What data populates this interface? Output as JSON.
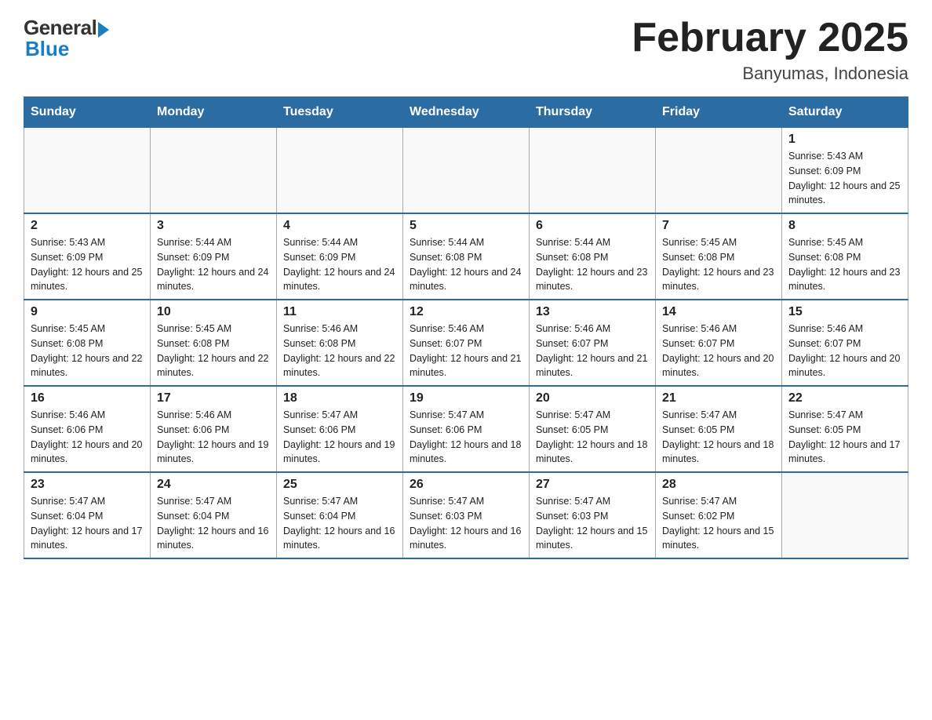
{
  "header": {
    "logo_general": "General",
    "logo_blue": "Blue",
    "month_title": "February 2025",
    "location": "Banyumas, Indonesia"
  },
  "weekdays": [
    "Sunday",
    "Monday",
    "Tuesday",
    "Wednesday",
    "Thursday",
    "Friday",
    "Saturday"
  ],
  "weeks": [
    [
      {
        "day": "",
        "info": ""
      },
      {
        "day": "",
        "info": ""
      },
      {
        "day": "",
        "info": ""
      },
      {
        "day": "",
        "info": ""
      },
      {
        "day": "",
        "info": ""
      },
      {
        "day": "",
        "info": ""
      },
      {
        "day": "1",
        "info": "Sunrise: 5:43 AM\nSunset: 6:09 PM\nDaylight: 12 hours and 25 minutes."
      }
    ],
    [
      {
        "day": "2",
        "info": "Sunrise: 5:43 AM\nSunset: 6:09 PM\nDaylight: 12 hours and 25 minutes."
      },
      {
        "day": "3",
        "info": "Sunrise: 5:44 AM\nSunset: 6:09 PM\nDaylight: 12 hours and 24 minutes."
      },
      {
        "day": "4",
        "info": "Sunrise: 5:44 AM\nSunset: 6:09 PM\nDaylight: 12 hours and 24 minutes."
      },
      {
        "day": "5",
        "info": "Sunrise: 5:44 AM\nSunset: 6:08 PM\nDaylight: 12 hours and 24 minutes."
      },
      {
        "day": "6",
        "info": "Sunrise: 5:44 AM\nSunset: 6:08 PM\nDaylight: 12 hours and 23 minutes."
      },
      {
        "day": "7",
        "info": "Sunrise: 5:45 AM\nSunset: 6:08 PM\nDaylight: 12 hours and 23 minutes."
      },
      {
        "day": "8",
        "info": "Sunrise: 5:45 AM\nSunset: 6:08 PM\nDaylight: 12 hours and 23 minutes."
      }
    ],
    [
      {
        "day": "9",
        "info": "Sunrise: 5:45 AM\nSunset: 6:08 PM\nDaylight: 12 hours and 22 minutes."
      },
      {
        "day": "10",
        "info": "Sunrise: 5:45 AM\nSunset: 6:08 PM\nDaylight: 12 hours and 22 minutes."
      },
      {
        "day": "11",
        "info": "Sunrise: 5:46 AM\nSunset: 6:08 PM\nDaylight: 12 hours and 22 minutes."
      },
      {
        "day": "12",
        "info": "Sunrise: 5:46 AM\nSunset: 6:07 PM\nDaylight: 12 hours and 21 minutes."
      },
      {
        "day": "13",
        "info": "Sunrise: 5:46 AM\nSunset: 6:07 PM\nDaylight: 12 hours and 21 minutes."
      },
      {
        "day": "14",
        "info": "Sunrise: 5:46 AM\nSunset: 6:07 PM\nDaylight: 12 hours and 20 minutes."
      },
      {
        "day": "15",
        "info": "Sunrise: 5:46 AM\nSunset: 6:07 PM\nDaylight: 12 hours and 20 minutes."
      }
    ],
    [
      {
        "day": "16",
        "info": "Sunrise: 5:46 AM\nSunset: 6:06 PM\nDaylight: 12 hours and 20 minutes."
      },
      {
        "day": "17",
        "info": "Sunrise: 5:46 AM\nSunset: 6:06 PM\nDaylight: 12 hours and 19 minutes."
      },
      {
        "day": "18",
        "info": "Sunrise: 5:47 AM\nSunset: 6:06 PM\nDaylight: 12 hours and 19 minutes."
      },
      {
        "day": "19",
        "info": "Sunrise: 5:47 AM\nSunset: 6:06 PM\nDaylight: 12 hours and 18 minutes."
      },
      {
        "day": "20",
        "info": "Sunrise: 5:47 AM\nSunset: 6:05 PM\nDaylight: 12 hours and 18 minutes."
      },
      {
        "day": "21",
        "info": "Sunrise: 5:47 AM\nSunset: 6:05 PM\nDaylight: 12 hours and 18 minutes."
      },
      {
        "day": "22",
        "info": "Sunrise: 5:47 AM\nSunset: 6:05 PM\nDaylight: 12 hours and 17 minutes."
      }
    ],
    [
      {
        "day": "23",
        "info": "Sunrise: 5:47 AM\nSunset: 6:04 PM\nDaylight: 12 hours and 17 minutes."
      },
      {
        "day": "24",
        "info": "Sunrise: 5:47 AM\nSunset: 6:04 PM\nDaylight: 12 hours and 16 minutes."
      },
      {
        "day": "25",
        "info": "Sunrise: 5:47 AM\nSunset: 6:04 PM\nDaylight: 12 hours and 16 minutes."
      },
      {
        "day": "26",
        "info": "Sunrise: 5:47 AM\nSunset: 6:03 PM\nDaylight: 12 hours and 16 minutes."
      },
      {
        "day": "27",
        "info": "Sunrise: 5:47 AM\nSunset: 6:03 PM\nDaylight: 12 hours and 15 minutes."
      },
      {
        "day": "28",
        "info": "Sunrise: 5:47 AM\nSunset: 6:02 PM\nDaylight: 12 hours and 15 minutes."
      },
      {
        "day": "",
        "info": ""
      }
    ]
  ]
}
